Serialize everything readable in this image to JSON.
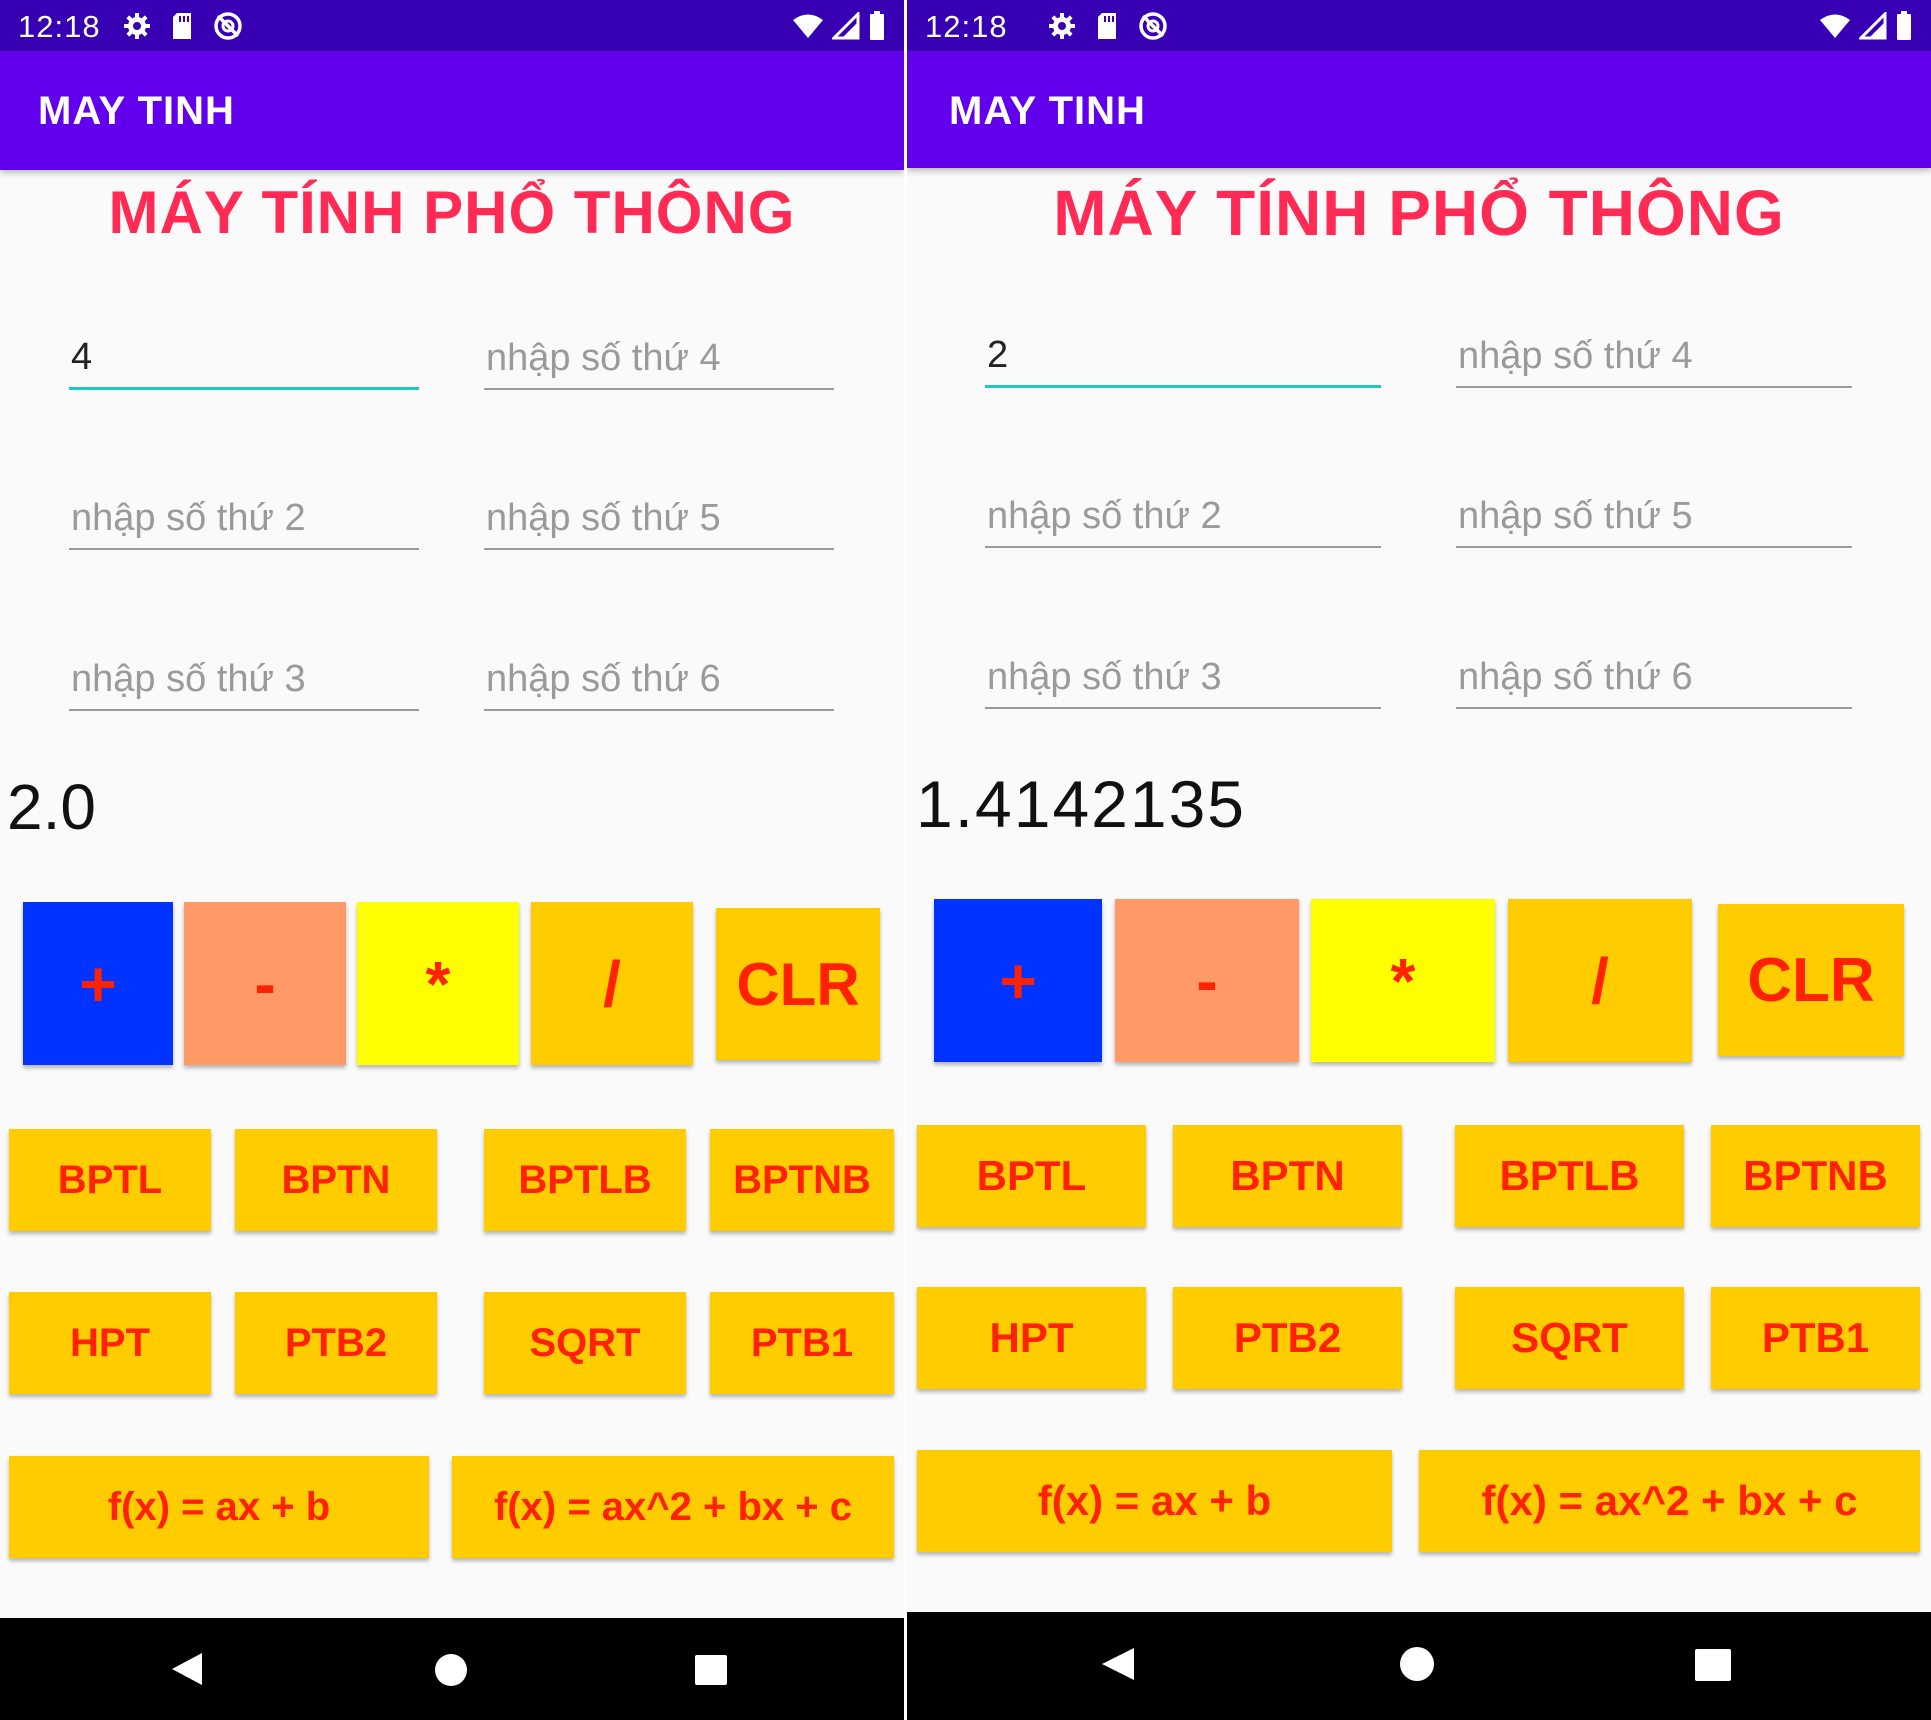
{
  "status_bar": {
    "time": "12:18"
  },
  "app_bar": {
    "title": "MAY TINH"
  },
  "heading": "MÁY TÍNH PHỔ THÔNG",
  "fields": {
    "f4_placeholder": "nhập số thứ 4",
    "f2_placeholder": "nhập số thứ 2",
    "f5_placeholder": "nhập số thứ 5",
    "f3_placeholder": "nhập số thứ 3",
    "f6_placeholder": "nhập số thứ 6"
  },
  "left": {
    "input1_value": "4",
    "result": "2.0"
  },
  "right": {
    "input1_value": "2",
    "result": "1.4142135"
  },
  "operators": {
    "plus": "+",
    "minus": "-",
    "multiply": "*",
    "divide": "/",
    "clear": "CLR"
  },
  "functions": {
    "bptl": "BPTL",
    "bptn": "BPTN",
    "bptlb": "BPTLB",
    "bptnb": "BPTNB",
    "hpt": "HPT",
    "ptb2": "PTB2",
    "sqrt": "SQRT",
    "ptb1": "PTB1",
    "linear": "f(x) = ax + b",
    "quadratic": "f(x) = ax^2 + bx + c"
  },
  "colors": {
    "status_bar": "#3700b3",
    "app_bar": "#6200ee",
    "heading": "#ff2b55",
    "plus_bg": "#0033ff",
    "minus_bg": "#ff9966",
    "multiply_bg": "#ffff00",
    "function_bg": "#ffcc00",
    "button_text": "#ff2200",
    "focus_line": "#1fc8c0"
  }
}
